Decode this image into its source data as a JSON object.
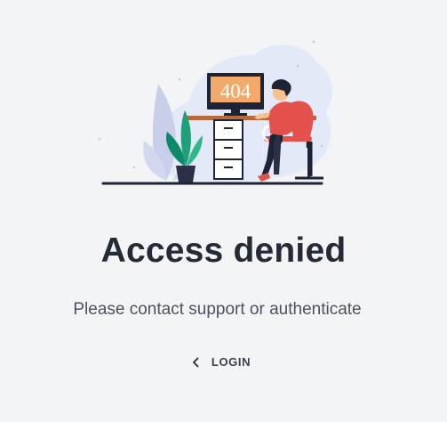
{
  "illustration": {
    "screen_text": "404",
    "icon": "person-at-computer-illustration"
  },
  "content": {
    "title": "Access denied",
    "message": "Please contact support or authenticate"
  },
  "login_button": {
    "label": "LOGIN",
    "icon": "chevron-left-icon"
  }
}
